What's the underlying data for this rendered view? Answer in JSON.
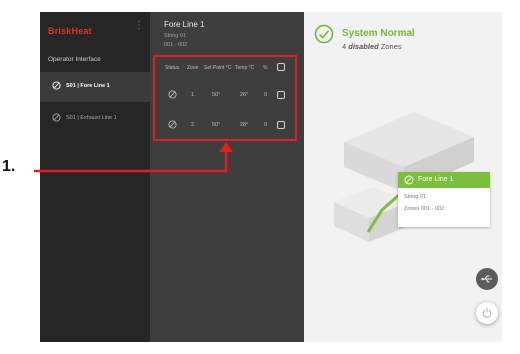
{
  "sidebar": {
    "brand": "BriskHeat",
    "section_label": "Operator Interface",
    "items": [
      {
        "label": "S01 | Fore Line 1",
        "icon": "disabled-icon"
      },
      {
        "label": "S01 | Exhaust Line 1",
        "icon": "disabled-icon"
      }
    ]
  },
  "detail": {
    "title": "Fore Line 1",
    "string": "String 01",
    "zone_range": "001 - 002",
    "table": {
      "headers": [
        "Status",
        "Zone",
        "Set Point °C",
        "Temp °C",
        "%"
      ],
      "rows": [
        {
          "zone": "1",
          "setpoint": "50°",
          "temp": "26°",
          "percent": "0"
        },
        {
          "zone": "2",
          "setpoint": "50°",
          "temp": "28°",
          "percent": "0"
        }
      ]
    }
  },
  "status": {
    "title": "System Normal",
    "count": "4",
    "count_word": "disabled",
    "zones_word": "Zones",
    "color": "#6fb83b"
  },
  "card": {
    "title": "Fore Line 1",
    "string": "String 01",
    "zones": "Zones 001 - 002"
  },
  "annotation": {
    "number": "1."
  }
}
